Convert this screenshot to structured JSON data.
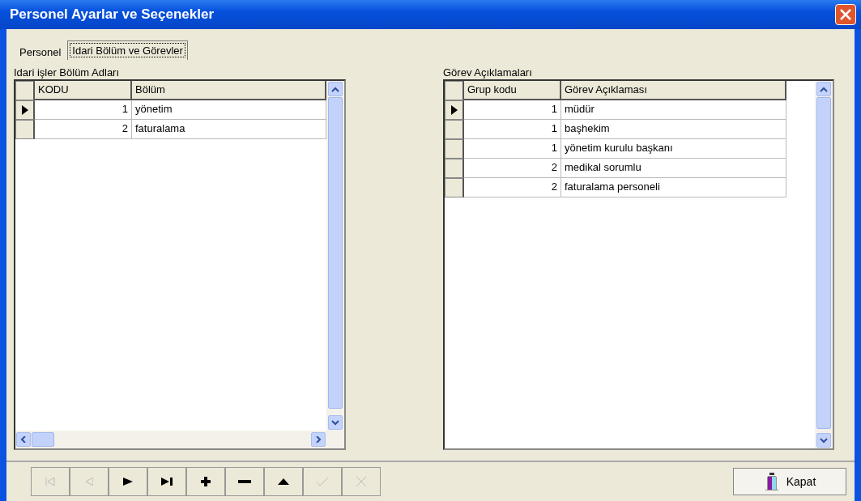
{
  "window": {
    "title": "Personel Ayarlar ve Seçenekler"
  },
  "tabs": [
    {
      "label": "Personel",
      "selected": false
    },
    {
      "label": "Idari Bölüm ve Görevler",
      "selected": true
    }
  ],
  "left_grid": {
    "caption": "Idari işler Bölüm Adları",
    "columns": [
      "KODU",
      "Bölüm"
    ],
    "rows": [
      {
        "cells": [
          "1",
          "yönetim"
        ],
        "selected": true
      },
      {
        "cells": [
          "2",
          "faturalama"
        ],
        "selected": false
      }
    ]
  },
  "right_grid": {
    "caption": "Görev Açıklamaları",
    "columns": [
      "Grup kodu",
      "Görev Açıklaması"
    ],
    "rows": [
      {
        "cells": [
          "1",
          "müdür"
        ],
        "selected": true
      },
      {
        "cells": [
          "1",
          "başhekim"
        ],
        "selected": false
      },
      {
        "cells": [
          "1",
          "yönetim kurulu başkanı"
        ],
        "selected": false
      },
      {
        "cells": [
          "2",
          "medikal sorumlu"
        ],
        "selected": false
      },
      {
        "cells": [
          "2",
          "faturalama personeli"
        ],
        "selected": false
      }
    ]
  },
  "navigator": [
    {
      "kind": "first",
      "disabled": true
    },
    {
      "kind": "prior",
      "disabled": true
    },
    {
      "kind": "next",
      "disabled": false
    },
    {
      "kind": "last",
      "disabled": false
    },
    {
      "kind": "insert",
      "disabled": false
    },
    {
      "kind": "delete",
      "disabled": false
    },
    {
      "kind": "edit",
      "disabled": false
    },
    {
      "kind": "post",
      "disabled": true
    },
    {
      "kind": "cancel",
      "disabled": true
    }
  ],
  "close_button": {
    "label": "Kapat"
  }
}
